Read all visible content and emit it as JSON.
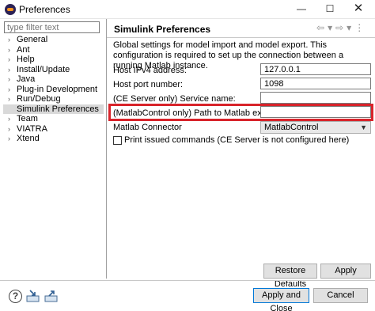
{
  "window": {
    "title": "Preferences",
    "minimize_glyph": "—",
    "maximize_glyph": "☐",
    "close_glyph": "✕"
  },
  "filter": {
    "placeholder": "type filter text"
  },
  "nav": {
    "items": [
      {
        "label": "General",
        "expandable": true
      },
      {
        "label": "Ant",
        "expandable": true
      },
      {
        "label": "Help",
        "expandable": true
      },
      {
        "label": "Install/Update",
        "expandable": true
      },
      {
        "label": "Java",
        "expandable": true
      },
      {
        "label": "Plug-in Development",
        "expandable": true
      },
      {
        "label": "Run/Debug",
        "expandable": true
      },
      {
        "label": "Simulink Preferences",
        "expandable": false,
        "selected": true
      },
      {
        "label": "Team",
        "expandable": true
      },
      {
        "label": "VIATRA",
        "expandable": true
      },
      {
        "label": "Xtend",
        "expandable": true
      }
    ]
  },
  "page": {
    "title": "Simulink Preferences",
    "description": "Global settings for model import and model export. This configuration is required to set up the connection between a running Matlab instance.",
    "fields": {
      "host_ip_label": "Host IPv4 address:",
      "host_ip_value": "127.0.0.1",
      "host_port_label": "Host port number:",
      "host_port_value": "1098",
      "service_name_label": "(CE Server only) Service name:",
      "service_name_value": "",
      "matlab_path_label": "(MatlabControl only) Path to Matlab executable:",
      "matlab_path_value": "",
      "connector_label": "Matlab Connector",
      "connector_value": "MatlabControl"
    },
    "print_commands_label": "Print issued commands (CE Server is not configured here)",
    "print_commands_checked": false,
    "highlight_color": "#d8232a"
  },
  "buttons": {
    "restore_defaults": "Restore Defaults",
    "apply": "Apply",
    "apply_and_close": "Apply and Close",
    "cancel": "Cancel"
  },
  "footer": {
    "help_icon_glyph": "?",
    "icons": [
      "help-icon",
      "import-icon",
      "export-icon"
    ]
  }
}
